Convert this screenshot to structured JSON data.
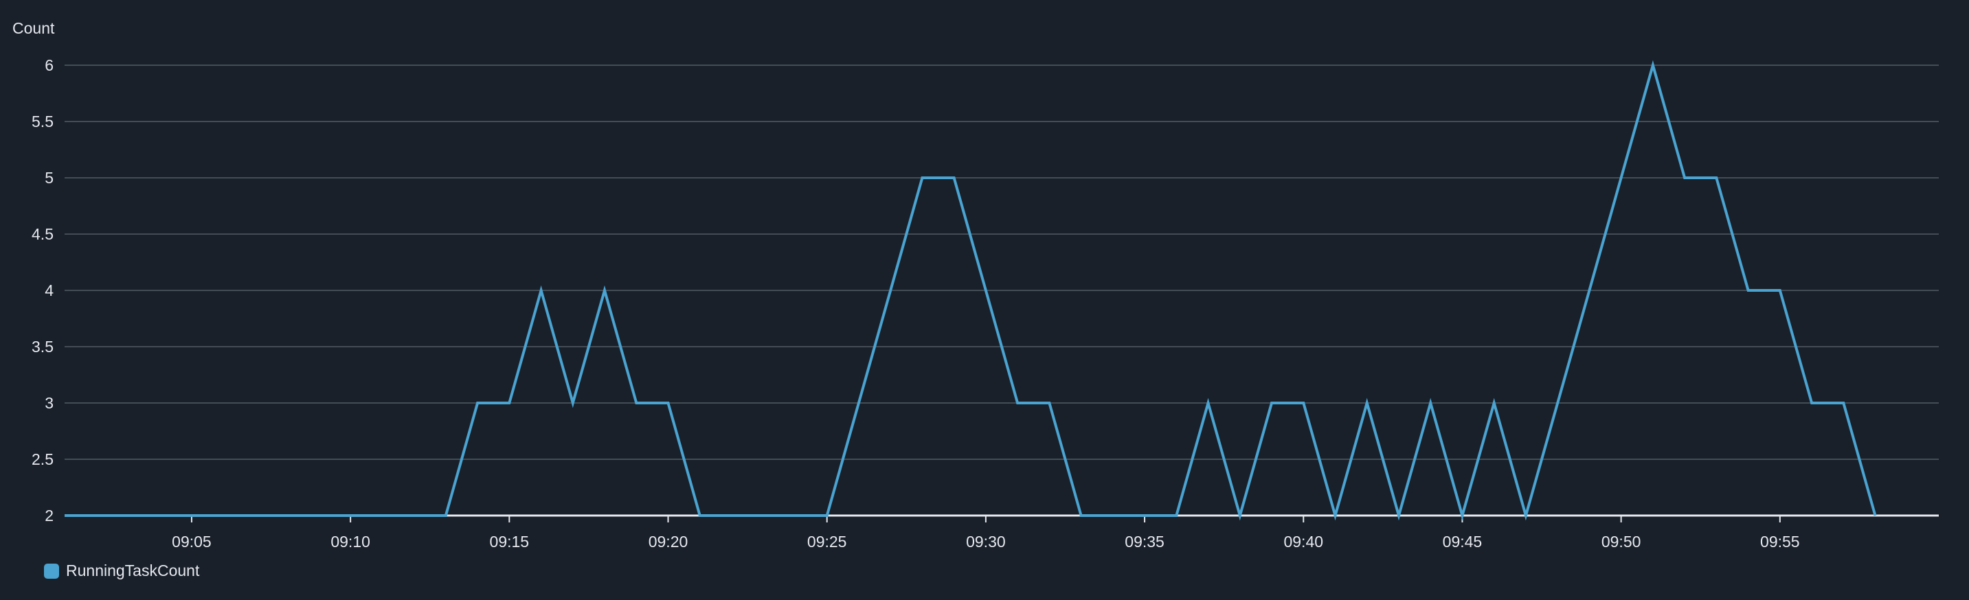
{
  "colors": {
    "background": "#19202a",
    "grid": "#5f6670",
    "baseline": "#e6e9ee",
    "series": "#4aa3d0",
    "text": "#e6e9ee"
  },
  "chart_data": {
    "type": "line",
    "title": "",
    "ylabel": "Count",
    "xlabel": "",
    "ylim": [
      2,
      6
    ],
    "xlim": [
      "09:01",
      "09:60"
    ],
    "y_ticks": [
      "2",
      "2.5",
      "3",
      "3.5",
      "4",
      "4.5",
      "5",
      "5.5",
      "6"
    ],
    "x_ticks": [
      "09:05",
      "09:10",
      "09:15",
      "09:20",
      "09:25",
      "09:30",
      "09:35",
      "09:40",
      "09:45",
      "09:50",
      "09:55"
    ],
    "grid": true,
    "legend_position": "bottom-left",
    "series": [
      {
        "name": "RunningTaskCount",
        "color": "#4aa3d0",
        "x": [
          "09:01",
          "09:02",
          "09:03",
          "09:04",
          "09:05",
          "09:06",
          "09:07",
          "09:08",
          "09:09",
          "09:10",
          "09:11",
          "09:12",
          "09:13",
          "09:14",
          "09:15",
          "09:16",
          "09:17",
          "09:18",
          "09:19",
          "09:20",
          "09:21",
          "09:22",
          "09:23",
          "09:24",
          "09:25",
          "09:26",
          "09:27",
          "09:28",
          "09:29",
          "09:30",
          "09:31",
          "09:32",
          "09:33",
          "09:34",
          "09:35",
          "09:36",
          "09:37",
          "09:38",
          "09:39",
          "09:40",
          "09:41",
          "09:42",
          "09:43",
          "09:44",
          "09:45",
          "09:46",
          "09:47",
          "09:48",
          "09:49",
          "09:50",
          "09:51",
          "09:52",
          "09:53",
          "09:54",
          "09:55",
          "09:56",
          "09:57",
          "09:58"
        ],
        "values": [
          2,
          2,
          2,
          2,
          2,
          2,
          2,
          2,
          2,
          2,
          2,
          2,
          2,
          3,
          3,
          4,
          3,
          4,
          3,
          3,
          2,
          2,
          2,
          2,
          2,
          3,
          4,
          5,
          5,
          4,
          3,
          3,
          2,
          2,
          2,
          2,
          3,
          2,
          3,
          3,
          2,
          3,
          2,
          3,
          2,
          3,
          2,
          3,
          4,
          5,
          6,
          5,
          5,
          4,
          4,
          3,
          3,
          2
        ]
      }
    ]
  }
}
